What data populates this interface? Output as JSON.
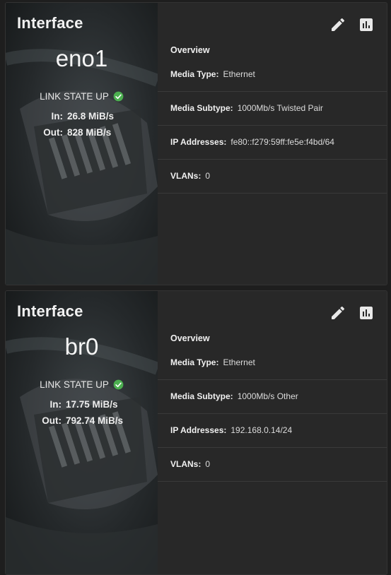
{
  "cards": [
    {
      "title": "Interface",
      "name": "eno1",
      "link_state": "LINK STATE UP",
      "in_label": "In:",
      "in_value": "26.8 MiB/s",
      "out_label": "Out:",
      "out_value": "828 MiB/s",
      "overview_title": "Overview",
      "rows": [
        {
          "label": "Media Type:",
          "value": "Ethernet"
        },
        {
          "label": "Media Subtype:",
          "value": "1000Mb/s Twisted Pair"
        },
        {
          "label": "IP Addresses:",
          "value": "fe80::f279:59ff:fe5e:f4bd/64"
        },
        {
          "label": "VLANs:",
          "value": "0"
        }
      ],
      "icons": {
        "edit": "pencil-edit-icon",
        "stats": "bar-chart-icon"
      }
    },
    {
      "title": "Interface",
      "name": "br0",
      "link_state": "LINK STATE UP",
      "in_label": "In:",
      "in_value": "17.75 MiB/s",
      "out_label": "Out:",
      "out_value": "792.74 MiB/s",
      "overview_title": "Overview",
      "rows": [
        {
          "label": "Media Type:",
          "value": "Ethernet"
        },
        {
          "label": "Media Subtype:",
          "value": "1000Mb/s Other"
        },
        {
          "label": "IP Addresses:",
          "value": "192.168.0.14/24"
        },
        {
          "label": "VLANs:",
          "value": "0"
        }
      ],
      "icons": {
        "edit": "pencil-edit-icon",
        "stats": "bar-chart-icon"
      }
    }
  ],
  "colors": {
    "page_bg": "#1e1e1e",
    "card_bg": "#282828",
    "status_ok": "#4caf50",
    "text": "#e8e8e8"
  }
}
